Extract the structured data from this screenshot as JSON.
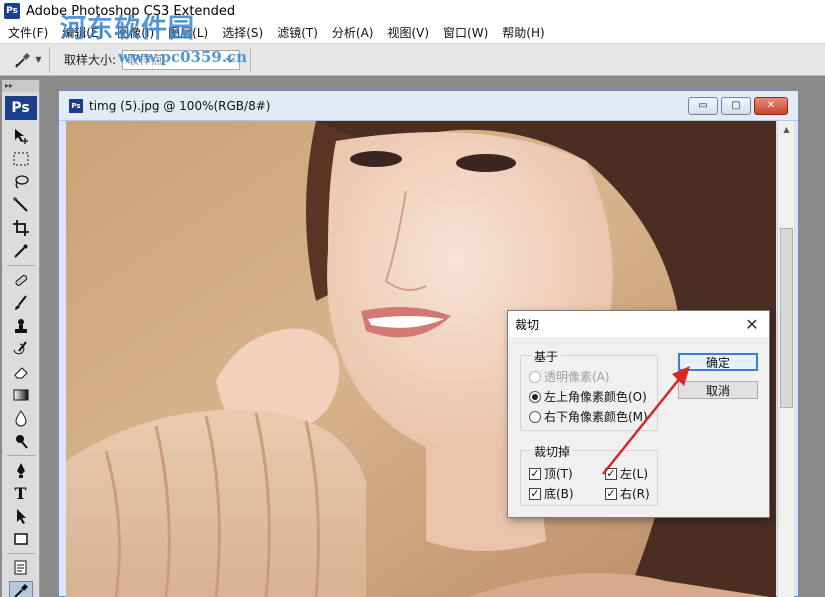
{
  "app": {
    "title": "Adobe Photoshop CS3 Extended",
    "logo": "Ps"
  },
  "watermark": {
    "brand": "河东软件园",
    "url": "www.pc0359.cn"
  },
  "menu": {
    "items": [
      "文件(F)",
      "编辑(E)",
      "图像(I)",
      "图层(L)",
      "选择(S)",
      "滤镜(T)",
      "分析(A)",
      "视图(V)",
      "窗口(W)",
      "帮助(H)"
    ]
  },
  "options_bar": {
    "sample_size_label": "取样大小:",
    "sample_size_value": "取样点",
    "tool_icon": "eyedropper-icon"
  },
  "toolbox": {
    "logo": "Ps",
    "collapse_glyph": "▸▸",
    "text_tool": "T"
  },
  "document": {
    "icon": "Ps",
    "title": "timg (5).jpg @ 100%(RGB/8#)",
    "minimize": "▭",
    "maximize": "▢",
    "close": "✕"
  },
  "dialog": {
    "title": "裁切",
    "close": "✕",
    "based_on": {
      "legend": "基于",
      "options": [
        {
          "label": "透明像素(A)",
          "checked": false,
          "disabled": true
        },
        {
          "label": "左上角像素颜色(O)",
          "checked": true,
          "disabled": false
        },
        {
          "label": "右下角像素颜色(M)",
          "checked": false,
          "disabled": false
        }
      ]
    },
    "trim_away": {
      "legend": "裁切掉",
      "top": {
        "label": "顶(T)",
        "checked": true
      },
      "bottom": {
        "label": "底(B)",
        "checked": true
      },
      "left": {
        "label": "左(L)",
        "checked": true
      },
      "right": {
        "label": "右(R)",
        "checked": true
      }
    },
    "ok_label": "确定",
    "cancel_label": "取消"
  },
  "colors": {
    "annotation_arrow": "#d9262b",
    "ps_blue": "#1b3f8c",
    "dialog_default_button_border": "#3b7ddb"
  }
}
